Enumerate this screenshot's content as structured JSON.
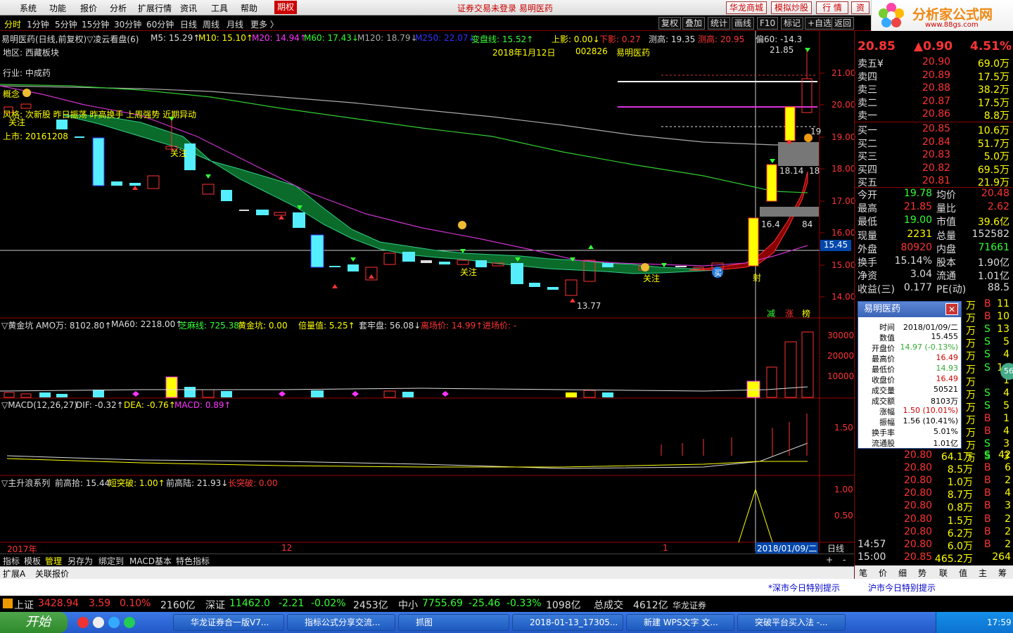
{
  "menu": {
    "items": [
      "系统",
      "功能",
      "报价",
      "分析",
      "扩展行情",
      "资讯",
      "工具",
      "帮助"
    ],
    "futures": "期权",
    "title": "证券交易未登录  易明医药",
    "buttons": [
      "华龙商城",
      "模拟炒股",
      "行  情",
      "资"
    ]
  },
  "logo": {
    "text": "分析家公式网",
    "url": "www.88gs.com"
  },
  "tabs": {
    "periods": [
      "分时",
      "1分钟",
      "5分钟",
      "15分钟",
      "30分钟",
      "60分钟",
      "日线",
      "周线",
      "月线",
      "更多 〉"
    ],
    "tools": [
      "复权",
      "叠加",
      "统计",
      "画线",
      "F10",
      "标记",
      "+自选",
      "返回"
    ]
  },
  "main": {
    "line1": {
      "name": "易明医药(日线,前复权)▽凌云看盘(6)",
      "m5": "M5: 15.29↑",
      "m10": "M10: 15.10↑",
      "m20": "M20: 14.94↑",
      "m60": "M60: 17.43↓",
      "m120": "M120: 18.79↓",
      "m250": "M250: 22.07↓",
      "bp": "变盘线: 15.52↑",
      "up": "上影: 0.00↓",
      "down": "下影: 0.27",
      "ch": "测高: 19.35",
      "cg": "测高: 20.95",
      "p60": "偏60: -14.3"
    },
    "region": "地区:  西藏板块",
    "date": "2018年1月12日",
    "code": "002826",
    "sname": "易明医药",
    "industry": "行业:  中成药",
    "concept": "概念",
    "style": "风格:  次新股 昨日振荡 昨高换手 上周强势 近期异动",
    "follow": "关注",
    "listing": "上市:  20161208",
    "prices": [
      "21.00",
      "20.00",
      "19.00",
      "18.00",
      "17.00",
      "16.00",
      "15.00",
      "14.00"
    ],
    "cur_price_tag": "15.45",
    "hi_label": "21.85",
    "lo_label": "13.77",
    "box1": "18.14",
    "box1b": "18",
    "box2": "16.4",
    "box2b": "84",
    "tag19": "19",
    "marks": [
      "减",
      "涨",
      "榜"
    ],
    "she": "射",
    "buy": "买",
    "follow2": "关注",
    "follow3": "关注"
  },
  "vol": {
    "name": "▽黄金坑 AMO万: 8102.80↑",
    "ma60": "MA60: 2218.00↑",
    "zml": "芝麻线: 725.38",
    "hjk": "黄金坑: 0.00",
    "bei": "倍量值: 5.25↑",
    "tlp": "套牢盘: 56.08↓",
    "lcj": "离场价: 14.99↑",
    "jcj": "进场价: -",
    "ticks": [
      "30000",
      "20000",
      "10000"
    ]
  },
  "macd": {
    "name": "▽MACD(12,26,27)",
    "dif": "DIF: -0.32↑",
    "dea": "DEA: -0.76↑",
    "macd": "MACD: 0.89↑",
    "tick": "1.50"
  },
  "zs": {
    "name": "▽主升浪系列",
    "qgs": "前高拾: 15.44",
    "dtp": "短突破: 1.00↑",
    "qgl": "前高陆: 21.93↓",
    "ctp": "长突破: 0.00",
    "ticks": [
      "1.00",
      "0.50"
    ]
  },
  "xaxis": {
    "y2017": "2017年",
    "m12": "12",
    "m1": "1",
    "cur": "2018/01/09/二",
    "period": "日线"
  },
  "bottom": {
    "tabs": [
      "指标",
      "模板",
      "管理",
      "另存为",
      "绑定到",
      "MACD基本",
      "特色指标"
    ],
    "plus": "+",
    "minus": "-"
  },
  "ext": {
    "tabs": [
      "扩展A",
      "关联报价"
    ]
  },
  "notice": {
    "a": "*深市今日特别提示",
    "b": "沪市今日特别提示"
  },
  "quote": {
    "price": "20.85",
    "chg": "▲0.90",
    "pct": "4.51%",
    "sell": [
      {
        "l": "卖五¥",
        "p": "20.90",
        "v": "69.0万"
      },
      {
        "l": "卖四",
        "p": "20.89",
        "v": "17.5万"
      },
      {
        "l": "卖三",
        "p": "20.88",
        "v": "38.2万"
      },
      {
        "l": "卖二",
        "p": "20.87",
        "v": "17.5万"
      },
      {
        "l": "卖一",
        "p": "20.86",
        "v": "8.8万"
      }
    ],
    "buy": [
      {
        "l": "买一",
        "p": "20.85",
        "v": "10.6万"
      },
      {
        "l": "买二",
        "p": "20.84",
        "v": "51.7万"
      },
      {
        "l": "买三",
        "p": "20.83",
        "v": "5.0万"
      },
      {
        "l": "买四",
        "p": "20.82",
        "v": "69.5万"
      },
      {
        "l": "买五",
        "p": "20.81",
        "v": "21.9万"
      }
    ],
    "stats": [
      {
        "a": "今开",
        "b": "19.78",
        "c": "均价",
        "d": "20.48"
      },
      {
        "a": "最高",
        "b": "21.85",
        "c": "量比",
        "d": "2.62"
      },
      {
        "a": "最低",
        "b": "19.00",
        "c": "市值",
        "d": "39.6亿"
      },
      {
        "a": "现量",
        "b": "2231",
        "c": "总量",
        "d": "152582"
      },
      {
        "a": "外盘",
        "b": "80920",
        "c": "内盘",
        "d": "71661"
      },
      {
        "a": "换手",
        "b": "15.14%",
        "c": "股本",
        "d": "1.90亿"
      },
      {
        "a": "净资",
        "b": "3.04",
        "c": "流通",
        "d": "1.01亿"
      },
      {
        "a": "收益(三)",
        "b": "0.177",
        "c": "PE(动)",
        "d": "88.5"
      }
    ],
    "trades": [
      {
        "p": "20.80",
        "v": "64.1万",
        "s": "S",
        "n": "42"
      },
      {
        "p": "20.80",
        "v": "8.5万",
        "s": "B",
        "n": "6"
      },
      {
        "p": "20.80",
        "v": "1.0万",
        "s": "B",
        "n": "2"
      },
      {
        "p": "20.80",
        "v": "8.7万",
        "s": "B",
        "n": "4"
      },
      {
        "p": "20.80",
        "v": "0.8万",
        "s": "B",
        "n": "3"
      },
      {
        "p": "20.80",
        "v": "1.5万",
        "s": "B",
        "n": "2"
      },
      {
        "p": "20.80",
        "v": "6.2万",
        "s": "B",
        "n": "2"
      },
      {
        "t": "14:57",
        "p": "20.80",
        "v": "6.0万",
        "s": "B",
        "n": "2"
      },
      {
        "t": "15:00",
        "p": "20.85",
        "v": "465.2万",
        "s": "",
        "n": "264"
      }
    ],
    "side": [
      {
        "s": "B",
        "n": "11"
      },
      {
        "s": "B",
        "n": "10"
      },
      {
        "s": "S",
        "n": "13"
      },
      {
        "s": "S",
        "n": "5"
      },
      {
        "s": "S",
        "n": "4"
      },
      {
        "s": "S",
        "n": "16"
      },
      {
        "s": "",
        "n": "1"
      },
      {
        "s": "S",
        "n": "4"
      },
      {
        "s": "S",
        "n": "5"
      },
      {
        "s": "B",
        "n": "1"
      },
      {
        "s": "B",
        "n": "4"
      },
      {
        "s": "S",
        "n": "3"
      },
      {
        "s": "S",
        "n": "3"
      }
    ],
    "bottom_tabs": [
      "笔",
      "价",
      "细",
      "势",
      "联",
      "值",
      "主",
      "筹"
    ]
  },
  "popup": {
    "title": "易明医药",
    "rows": [
      {
        "l": "时间",
        "v": "2018/01/09/二"
      },
      {
        "l": "数值",
        "v": "15.455"
      },
      {
        "l": "开盘价",
        "v": "14.97 (-0.13%)"
      },
      {
        "l": "最高价",
        "v": "16.49"
      },
      {
        "l": "最低价",
        "v": "14.93"
      },
      {
        "l": "收盘价",
        "v": "16.49"
      },
      {
        "l": "成交量",
        "v": "50521"
      },
      {
        "l": "成交额",
        "v": "8103万"
      },
      {
        "l": "涨幅",
        "v": "1.50 (10.01%)"
      },
      {
        "l": "振幅",
        "v": "1.56 (10.41%)"
      },
      {
        "l": "换手率",
        "v": "5.01%"
      },
      {
        "l": "流通股",
        "v": "1.01亿"
      }
    ]
  },
  "ticker": {
    "sh": "上证",
    "shv": "3428.94",
    "shc": "3.59",
    "shp": "0.10%",
    "sha": "2160亿",
    "sz": "深证",
    "szv": "11462.0",
    "szc": "-2.21",
    "szp": "-0.02%",
    "sza": "2453亿",
    "zx": "中小",
    "zxv": "7755.69",
    "zxc": "-25.46",
    "zxp": "-0.33%",
    "zxa": "1098亿",
    "tot": "总成交",
    "tota": "4612亿",
    "broker": "华龙证券"
  },
  "taskbar": {
    "start": "开始",
    "tasks": [
      "华龙证券合一版V7...",
      "指标公式分享交流...",
      "抓图",
      "2018-01-13_17305...",
      "新建 WPS文字 文...",
      "突破平台买入法 -..."
    ],
    "clock": "17:59"
  },
  "circle": "56"
}
